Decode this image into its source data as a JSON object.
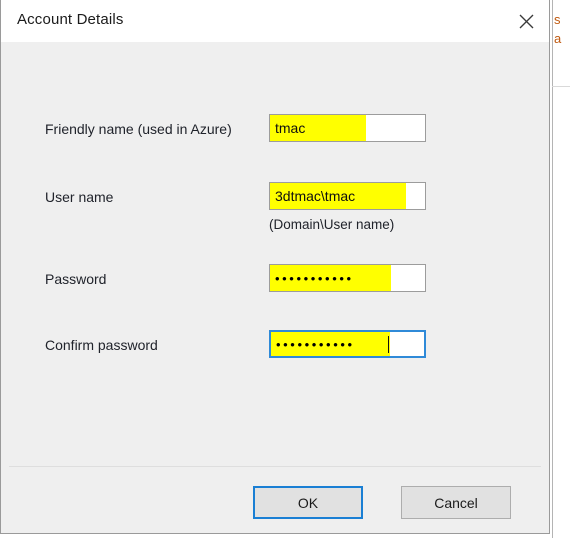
{
  "background_window": {
    "text_fragment_1": "s",
    "text_fragment_2": "a"
  },
  "dialog": {
    "title": "Account Details",
    "close_icon": "close-icon",
    "fields": [
      {
        "label": "Friendly name (used in Azure)",
        "value": "tmac",
        "highlight_color": "#ffff00",
        "highlight_ratio": 0.62,
        "focused": false,
        "masked": false
      },
      {
        "label": "User name",
        "value": "3dtmac\\tmac",
        "hint": "(Domain\\User name)",
        "highlight_color": "#ffff00",
        "highlight_ratio": 0.88,
        "focused": false,
        "masked": false
      },
      {
        "label": "Password",
        "value": "•••••••••••",
        "dot_count": 11,
        "highlight_color": "#ffff00",
        "highlight_ratio": 0.78,
        "focused": false,
        "masked": true
      },
      {
        "label": "Confirm password",
        "value": "•••••••••••",
        "dot_count": 11,
        "highlight_color": "#ffff00",
        "highlight_ratio": 0.78,
        "focused": true,
        "masked": true,
        "caret": true
      }
    ],
    "buttons": {
      "ok": "OK",
      "cancel": "Cancel",
      "default_button": "ok"
    },
    "colors": {
      "body": "#efefef",
      "titlebar": "#ffffff",
      "focus_border": "#2f8ad8",
      "default_button_border": "#1a7fd4",
      "highlight": "#ffff00"
    }
  }
}
